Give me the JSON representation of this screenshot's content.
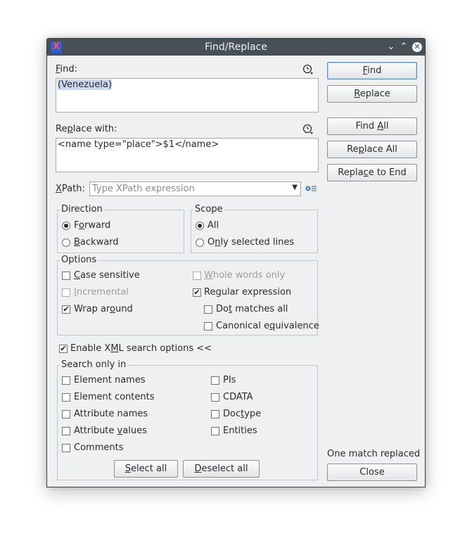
{
  "window": {
    "title": "Find/Replace"
  },
  "find": {
    "label_pre": "",
    "label_u": "F",
    "label_post": "ind:",
    "value": "(Venezuela)"
  },
  "replace": {
    "label_pre": "Re",
    "label_u": "p",
    "label_post": "lace with:",
    "value": "<name type=\"place\">$1</name>"
  },
  "xpath": {
    "label_pre": "",
    "label_u": "X",
    "label_post": "Path:",
    "placeholder": "Type XPath expression"
  },
  "buttons": {
    "find": {
      "pre": "",
      "u": "F",
      "post": "ind"
    },
    "replace": {
      "pre": "",
      "u": "R",
      "post": "eplace"
    },
    "find_all": {
      "pre": "Find ",
      "u": "A",
      "post": "ll"
    },
    "replace_all": {
      "pre": "Re",
      "u": "p",
      "post": "lace All"
    },
    "replace_to_end": {
      "pre": "Repla",
      "u": "c",
      "post": "e to End"
    },
    "close": "Close",
    "select_all": {
      "pre": "",
      "u": "S",
      "post": "elect all"
    },
    "deselect_all": {
      "pre": "",
      "u": "D",
      "post": "eselect all"
    }
  },
  "direction": {
    "title": "Direction",
    "forward": {
      "pre": "F",
      "u": "o",
      "post": "rward",
      "checked": true
    },
    "backward": {
      "pre": "",
      "u": "B",
      "post": "ackward",
      "checked": false
    }
  },
  "scope": {
    "title": "Scope",
    "all": {
      "label": "All",
      "checked": true
    },
    "selected": {
      "pre": "O",
      "u": "n",
      "post": "ly selected lines",
      "checked": false
    }
  },
  "options": {
    "title": "Options",
    "case_sensitive": {
      "pre": "",
      "u": "C",
      "post": "ase sensitive",
      "checked": false
    },
    "whole_words": {
      "pre": "",
      "u": "W",
      "post": "hole words only",
      "checked": false
    },
    "incremental": {
      "pre": "",
      "u": "I",
      "post": "ncremental",
      "checked": false
    },
    "regex": {
      "pre": "Re",
      "u": "g",
      "post": "ular expression",
      "checked": true
    },
    "wrap_around": {
      "pre": "Wrap ar",
      "u": "o",
      "post": "und",
      "checked": true
    },
    "dot_matches": {
      "pre": "Do",
      "u": "t",
      "post": " matches all",
      "checked": false
    },
    "canonical": {
      "pre": "Canonical e",
      "u": "q",
      "post": "uivalence",
      "checked": false
    }
  },
  "xml": {
    "pre": "Enable X",
    "u": "M",
    "post": "L search options <<",
    "checked": true
  },
  "search_only_in": {
    "title": "Search only in",
    "element_names": "Element names",
    "element_contents": "Element contents",
    "attribute_names": "Attribute names",
    "attribute_values": {
      "pre": "Attribute ",
      "u": "v",
      "post": "alues"
    },
    "comments": "Comments",
    "pis": "PIs",
    "cdata": "CDATA",
    "doctype": {
      "pre": "Doc",
      "u": "t",
      "post": "ype"
    },
    "entities": "Entities"
  },
  "status": "One match replaced"
}
